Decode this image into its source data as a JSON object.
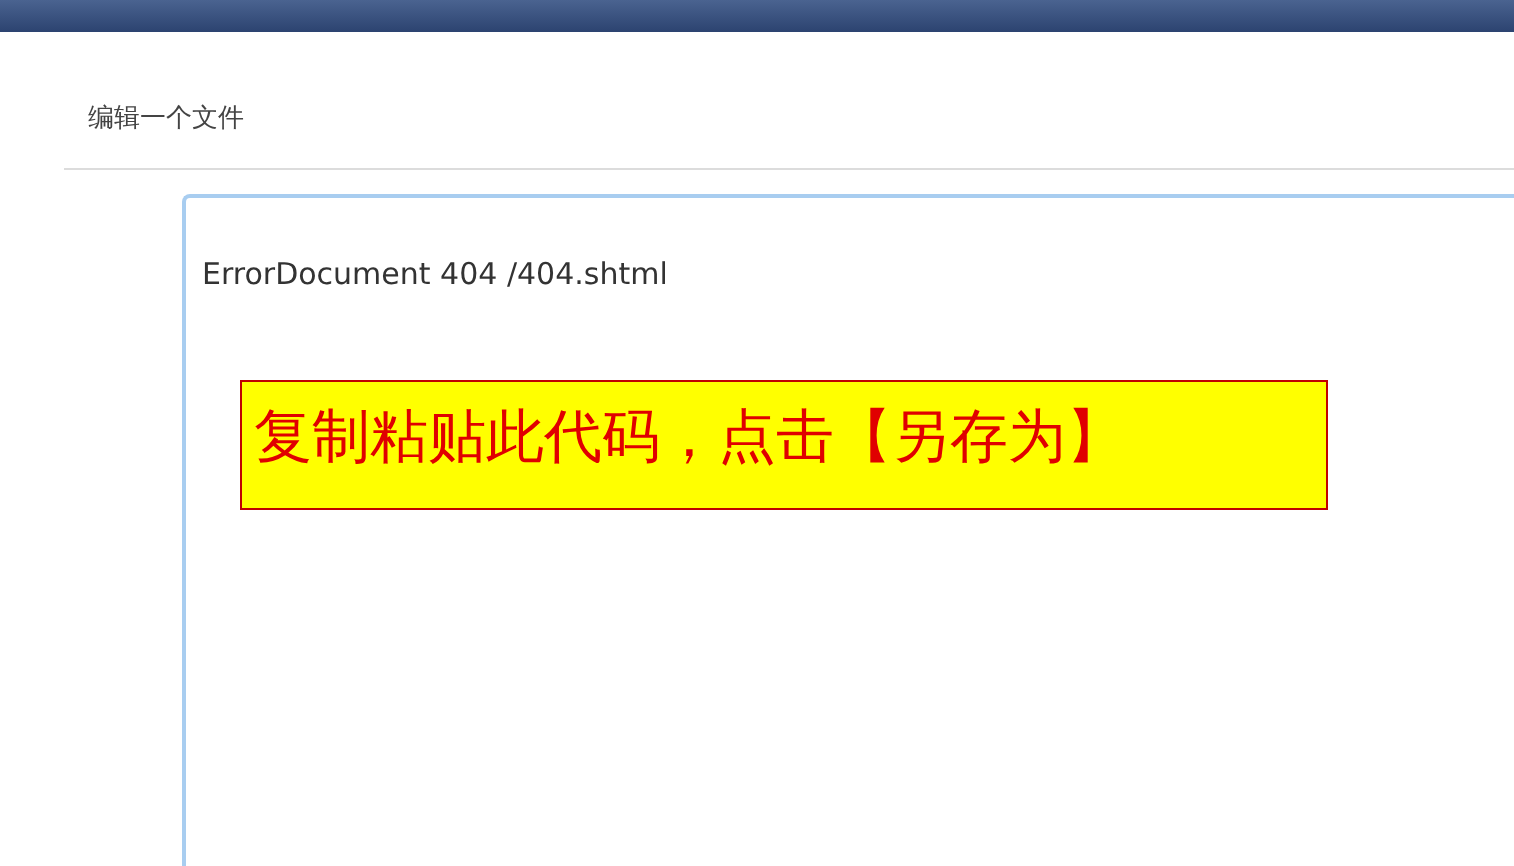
{
  "page": {
    "heading": "编辑一个文件"
  },
  "editor": {
    "value": "ErrorDocument 404 /404.shtml"
  },
  "annotation": {
    "text": "复制粘贴此代码，点击【另存为】"
  }
}
